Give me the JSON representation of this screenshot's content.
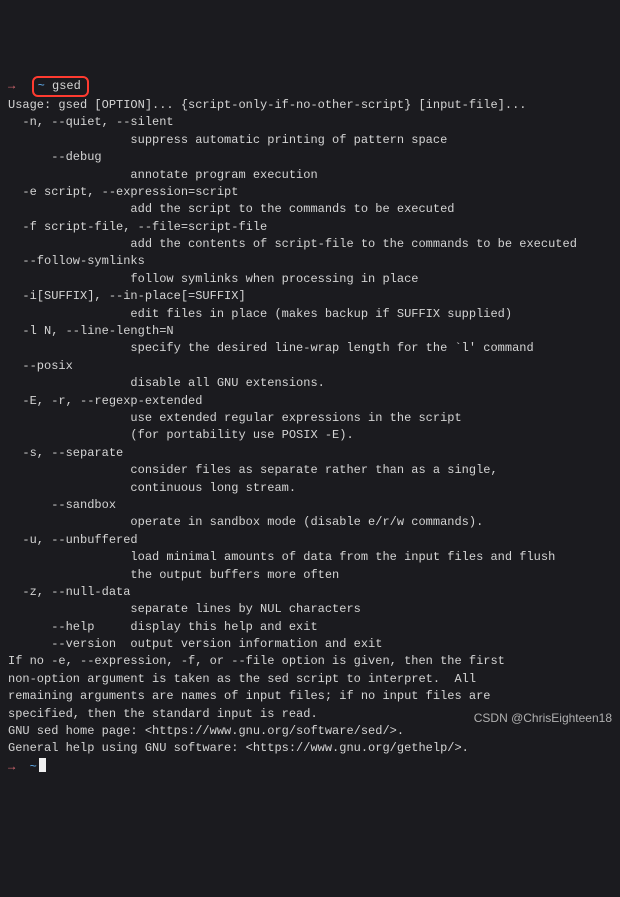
{
  "prompt1": {
    "arrow": "→",
    "tilde": "~",
    "cmd": "gsed"
  },
  "out": [
    "Usage: gsed [OPTION]... {script-only-if-no-other-script} [input-file]...",
    "",
    "  -n, --quiet, --silent",
    "                 suppress automatic printing of pattern space",
    "      --debug",
    "                 annotate program execution",
    "  -e script, --expression=script",
    "                 add the script to the commands to be executed",
    "  -f script-file, --file=script-file",
    "                 add the contents of script-file to the commands to be executed",
    "  --follow-symlinks",
    "                 follow symlinks when processing in place",
    "  -i[SUFFIX], --in-place[=SUFFIX]",
    "                 edit files in place (makes backup if SUFFIX supplied)",
    "  -l N, --line-length=N",
    "                 specify the desired line-wrap length for the `l' command",
    "  --posix",
    "                 disable all GNU extensions.",
    "  -E, -r, --regexp-extended",
    "                 use extended regular expressions in the script",
    "                 (for portability use POSIX -E).",
    "  -s, --separate",
    "                 consider files as separate rather than as a single,",
    "                 continuous long stream.",
    "      --sandbox",
    "                 operate in sandbox mode (disable e/r/w commands).",
    "  -u, --unbuffered",
    "                 load minimal amounts of data from the input files and flush",
    "                 the output buffers more often",
    "  -z, --null-data",
    "                 separate lines by NUL characters",
    "      --help     display this help and exit",
    "      --version  output version information and exit",
    "",
    "If no -e, --expression, -f, or --file option is given, then the first",
    "non-option argument is taken as the sed script to interpret.  All",
    "remaining arguments are names of input files; if no input files are",
    "specified, then the standard input is read.",
    "",
    "GNU sed home page: <https://www.gnu.org/software/sed/>.",
    "General help using GNU software: <https://www.gnu.org/gethelp/>."
  ],
  "prompt2": {
    "arrow": "→",
    "tilde": "~"
  },
  "watermark": "CSDN @ChrisEighteen18"
}
